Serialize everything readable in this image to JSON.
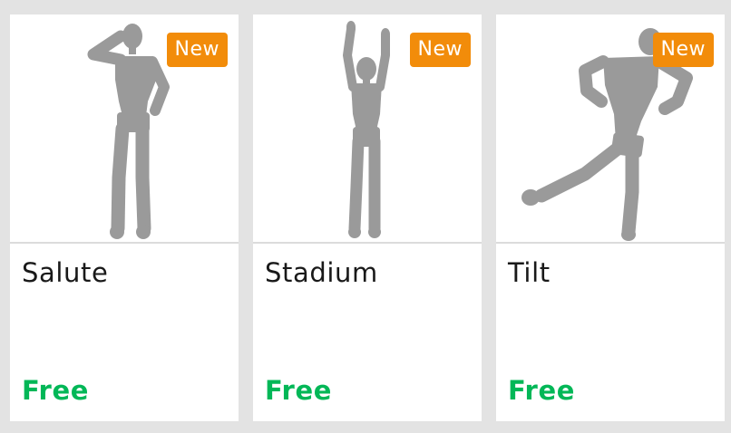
{
  "colors": {
    "background": "#e3e3e3",
    "card": "#ffffff",
    "badge": "#f28c0a",
    "price": "#02b757",
    "figure": "#9a9a9a"
  },
  "items": [
    {
      "name": "Salute",
      "badge": "New",
      "price": "Free",
      "figure_icon": "salute-pose-figure-icon"
    },
    {
      "name": "Stadium",
      "badge": "New",
      "price": "Free",
      "figure_icon": "stadium-pose-figure-icon"
    },
    {
      "name": "Tilt",
      "badge": "New",
      "price": "Free",
      "figure_icon": "tilt-pose-figure-icon"
    }
  ]
}
